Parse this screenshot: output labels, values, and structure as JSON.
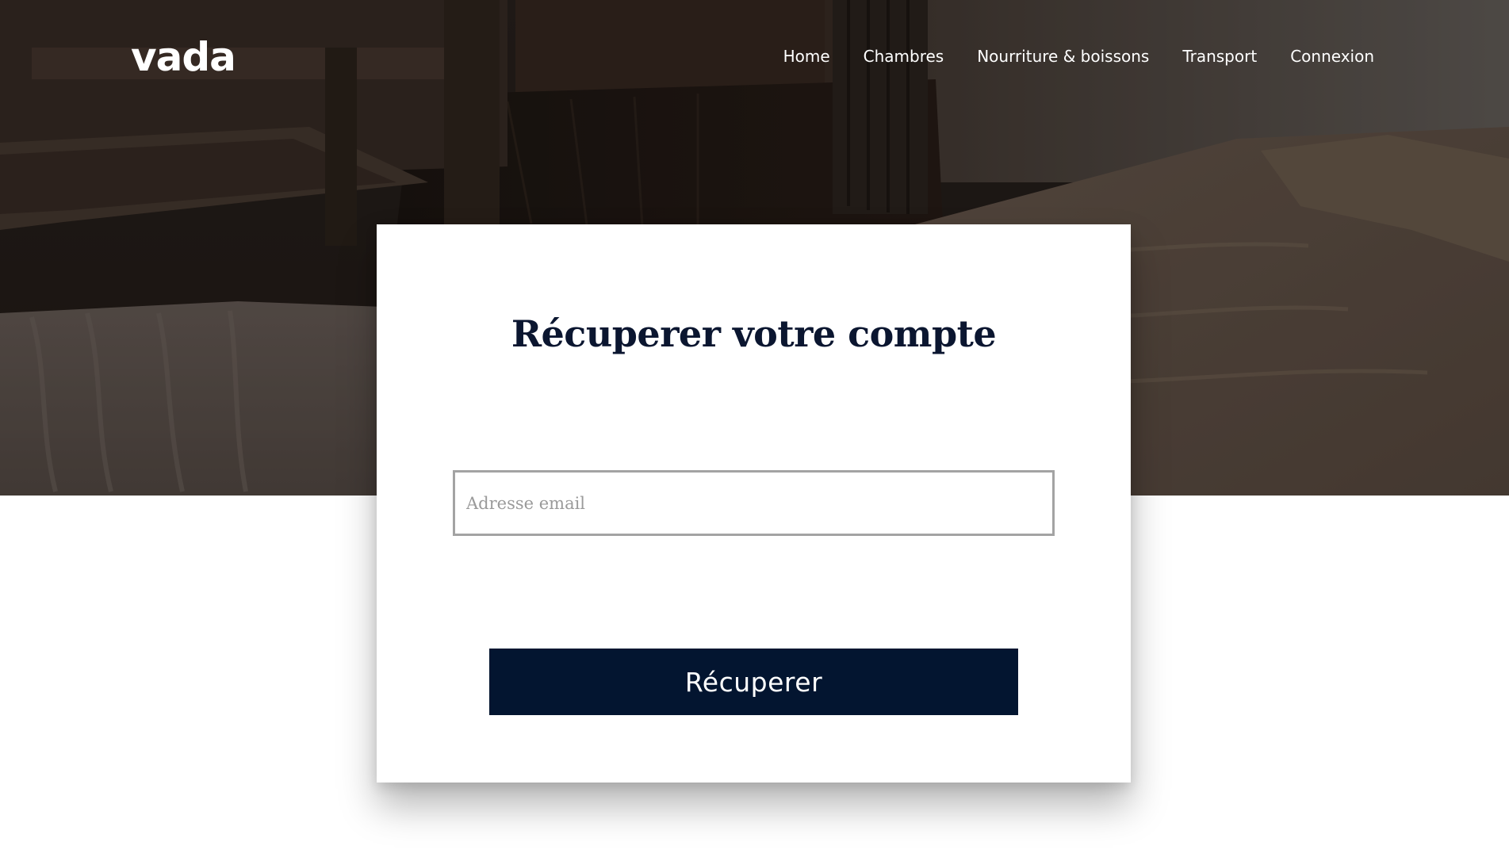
{
  "brand": {
    "logo_text": "vada"
  },
  "nav": {
    "items": [
      {
        "label": "Home"
      },
      {
        "label": "Chambres"
      },
      {
        "label": "Nourriture & boissons"
      },
      {
        "label": "Transport"
      },
      {
        "label": "Connexion"
      }
    ]
  },
  "recovery_form": {
    "title": "Récuperer votre compte",
    "email_placeholder": "Adresse email",
    "email_value": "",
    "submit_label": "Récuperer"
  },
  "colors": {
    "primary": "#031530",
    "title_text": "#0b1630",
    "input_border": "#a3a3a3",
    "nav_text": "#ffffff"
  },
  "icons": {
    "hero": "spa-massage-room-photo"
  }
}
